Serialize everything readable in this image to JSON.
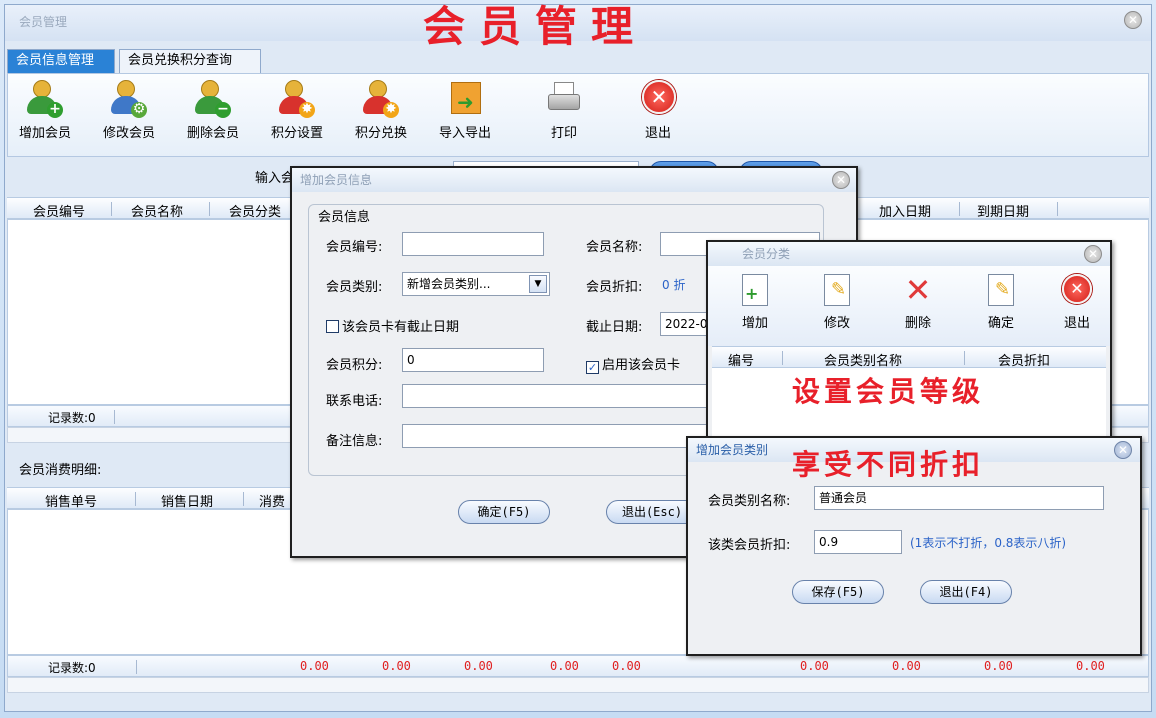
{
  "main": {
    "window_title": "会员管理",
    "banner": "会员管理",
    "tabs": [
      "会员信息管理",
      "会员兑换积分查询"
    ],
    "toolbar": [
      "增加会员",
      "修改会员",
      "删除会员",
      "积分设置",
      "积分兑换",
      "导入导出",
      "打印",
      "退出"
    ],
    "search_label": "输入会",
    "columns": [
      "会员编号",
      "会员名称",
      "会员分类",
      "加入日期",
      "到期日期"
    ],
    "record_count": "记录数:0",
    "consume_title": "会员消费明细:",
    "consume_columns": [
      "销售单号",
      "销售日期",
      "消费"
    ],
    "footer_count": "记录数:0",
    "footer_values": [
      "0.00",
      "0.00",
      "0.00",
      "0.00",
      "0.00",
      "0.00",
      "0.00",
      "0.00",
      "0.00"
    ]
  },
  "add_member": {
    "title": "增加会员信息",
    "group": "会员信息",
    "member_no_label": "会员编号:",
    "member_name_label": "会员名称:",
    "member_type_label": "会员类别:",
    "member_type_value": "新增会员类别...",
    "discount_label": "会员折扣:",
    "discount_value": "0 折",
    "expiry_check": "该会员卡有截止日期",
    "expiry_label": "截止日期:",
    "expiry_value": "2022-0",
    "points_label": "会员积分:",
    "points_value": "0",
    "enable_check": "启用该会员卡",
    "phone_label": "联系电话:",
    "notes_label": "备注信息:",
    "ok": "确定(F5)",
    "exit": "退出(Esc)"
  },
  "member_category": {
    "title": "会员分类",
    "toolbar": [
      "增加",
      "修改",
      "删除",
      "确定",
      "退出"
    ],
    "columns": [
      "编号",
      "会员类别名称",
      "会员折扣"
    ],
    "caption": "设置会员等级"
  },
  "add_category": {
    "title": "增加会员类别",
    "caption": "享受不同折扣",
    "name_label": "会员类别名称:",
    "name_value": "普通会员",
    "discount_label": "该类会员折扣:",
    "discount_value": "0.9",
    "hint": "(1表示不打折，0.8表示八折)",
    "save": "保存(F5)",
    "exit": "退出(F4)"
  },
  "colors": {
    "accent": "#2a82d6",
    "title_red": "#e8202a",
    "hint_blue": "#2b63c8"
  }
}
